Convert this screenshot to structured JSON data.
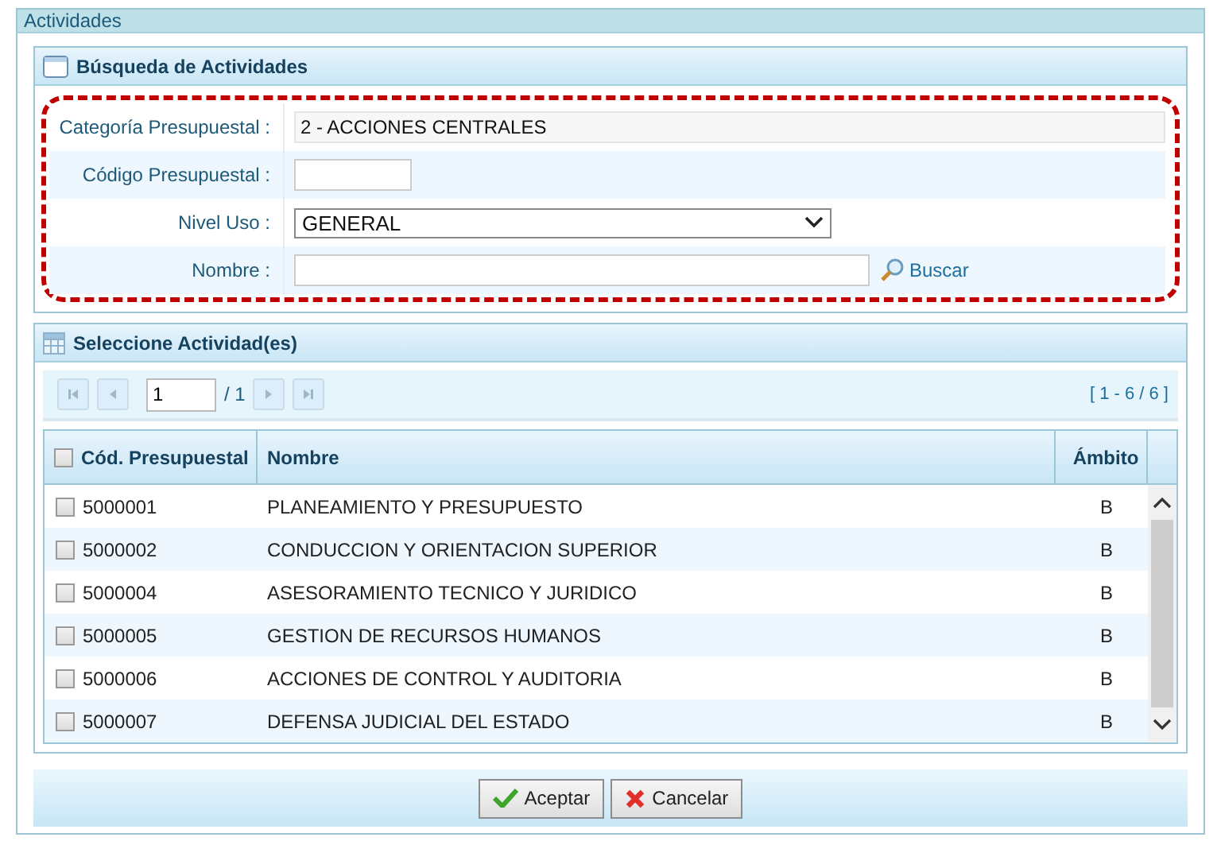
{
  "window": {
    "title": "Actividades"
  },
  "search_panel": {
    "title": "Búsqueda de Actividades",
    "fields": [
      {
        "kind": "readonly",
        "label": "Categoría Presupuestal :",
        "value": "2 - ACCIONES CENTRALES"
      },
      {
        "kind": "short",
        "label": "Código Presupuestal :"
      },
      {
        "kind": "select",
        "label": "Nivel Uso :",
        "value": "GENERAL"
      },
      {
        "kind": "search",
        "label": "Nombre :",
        "button": "Buscar"
      }
    ]
  },
  "grid_panel": {
    "title": "Seleccione Actividad(es)",
    "pager": {
      "page": "1",
      "total": "/ 1",
      "range": "[ 1 - 6 / 6 ]"
    },
    "columns": [
      "Cód. Presupuestal",
      "Nombre",
      "Ámbito"
    ],
    "header_checked": false,
    "rows": [
      {
        "code": "5000001",
        "name": "PLANEAMIENTO Y PRESUPUESTO",
        "scope": "B",
        "checked": false
      },
      {
        "code": "5000002",
        "name": "CONDUCCION Y ORIENTACION SUPERIOR",
        "scope": "B",
        "checked": false
      },
      {
        "code": "5000004",
        "name": "ASESORAMIENTO TECNICO Y JURIDICO",
        "scope": "B",
        "checked": false
      },
      {
        "code": "5000005",
        "name": "GESTION DE RECURSOS HUMANOS",
        "scope": "B",
        "checked": false
      },
      {
        "code": "5000006",
        "name": "ACCIONES DE CONTROL Y AUDITORIA",
        "scope": "B",
        "checked": false
      },
      {
        "code": "5000007",
        "name": "DEFENSA JUDICIAL DEL ESTADO",
        "scope": "B",
        "checked": false
      }
    ]
  },
  "buttons": [
    {
      "kind": "accept",
      "label": "Aceptar"
    },
    {
      "kind": "cancel",
      "label": "Cancelar"
    }
  ]
}
